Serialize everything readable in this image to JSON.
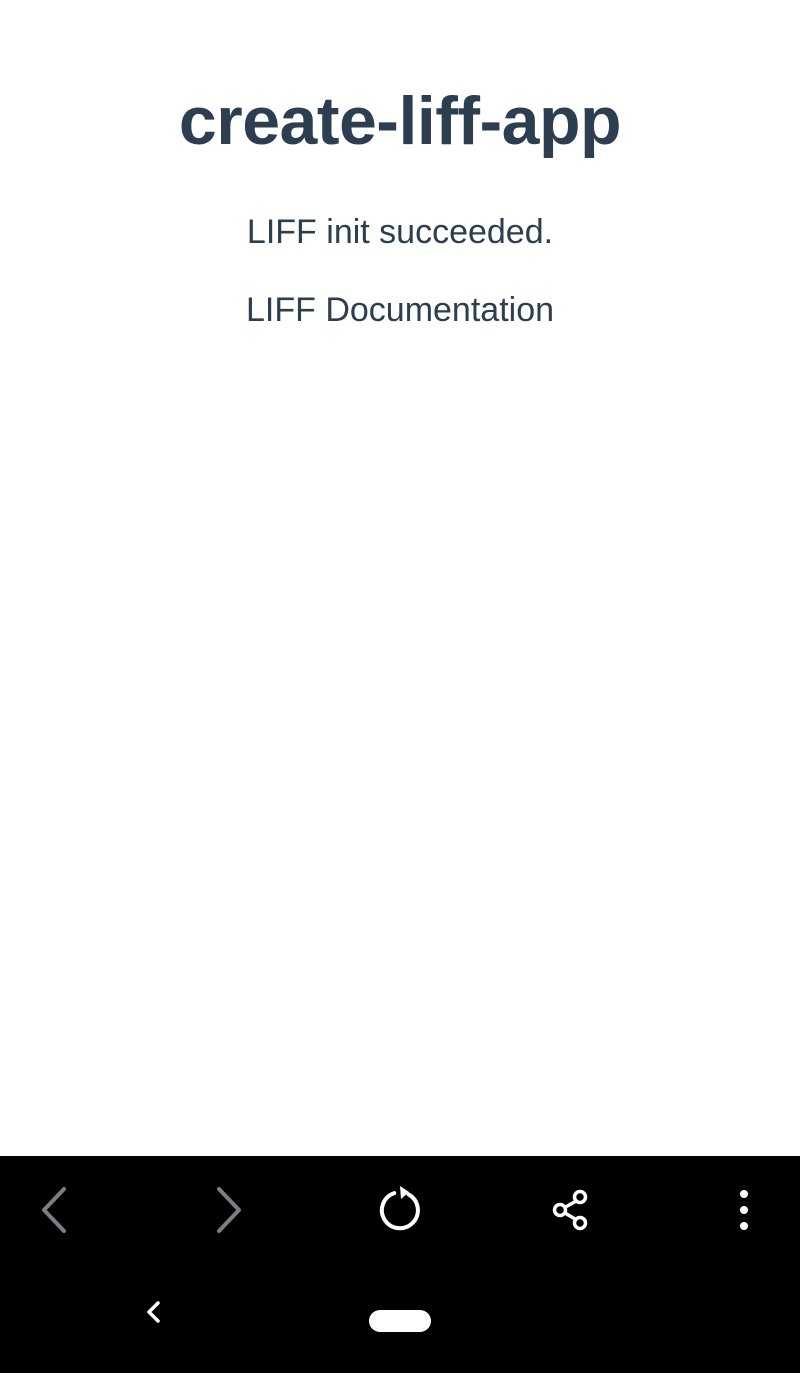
{
  "page": {
    "title": "create-liff-app",
    "status": "LIFF init succeeded.",
    "doc_link_label": "LIFF Documentation"
  },
  "browser_toolbar": {
    "icons": [
      "back-arrow-icon",
      "forward-arrow-icon",
      "reload-icon",
      "share-icon",
      "more-vert-icon"
    ]
  },
  "system_nav": {
    "icons": [
      "back-chevron-icon",
      "home-pill"
    ]
  },
  "colors": {
    "text": "#2c3e50",
    "background": "#ffffff",
    "toolbar": "#000000",
    "icon_disabled": "#7b7f83",
    "icon_enabled": "#ffffff"
  }
}
